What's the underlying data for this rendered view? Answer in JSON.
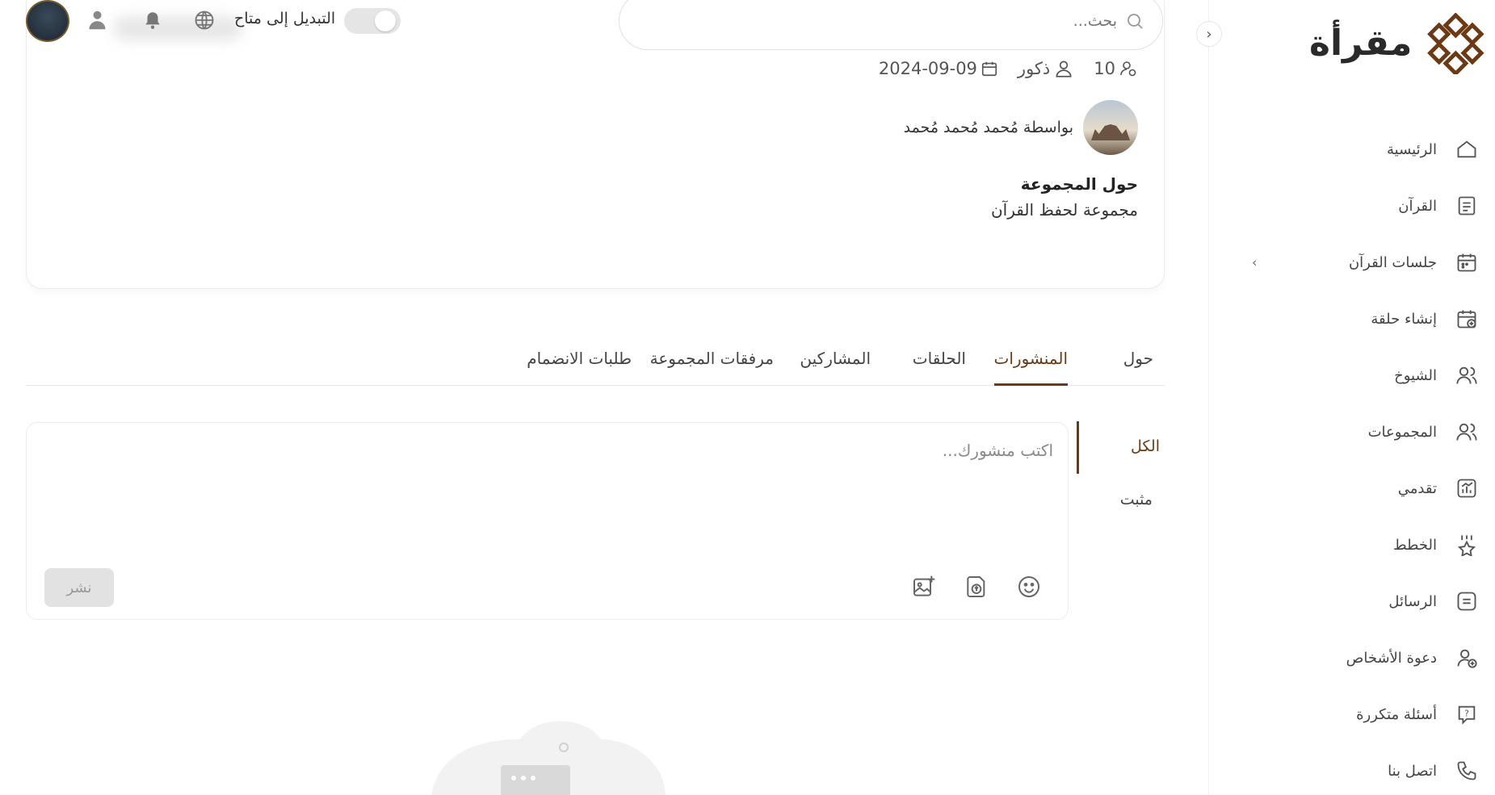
{
  "brand": {
    "name": "مقرأة",
    "accent": "#6b3a14"
  },
  "sidebar": {
    "items": [
      {
        "label": "الرئيسية",
        "icon": "home-icon"
      },
      {
        "label": "القرآن",
        "icon": "book-icon"
      },
      {
        "label": "جلسات القرآن",
        "icon": "calendar-icon",
        "has_submenu": true
      },
      {
        "label": "إنشاء حلقة",
        "icon": "calendar-add-icon"
      },
      {
        "label": "الشيوخ",
        "icon": "people-icon"
      },
      {
        "label": "المجموعات",
        "icon": "groups-icon"
      },
      {
        "label": "تقدمي",
        "icon": "progress-chart-icon"
      },
      {
        "label": "الخطط",
        "icon": "star-badge-icon"
      },
      {
        "label": "الرسائل",
        "icon": "message-icon"
      },
      {
        "label": "دعوة الأشخاص",
        "icon": "invite-user-icon"
      },
      {
        "label": "أسئلة متكررة",
        "icon": "faq-icon"
      },
      {
        "label": "اتصل بنا",
        "icon": "phone-icon"
      }
    ],
    "submenu_chevron": "‹",
    "collapse_chevron": "›"
  },
  "header": {
    "search_placeholder": "بحث...",
    "switch_label": "التبديل إلى متاح",
    "switch_on": false
  },
  "group": {
    "members_count": "10",
    "gender": "ذكور",
    "created_date": "2024-09-09",
    "by_text": "بواسطة مُحمد مُحمد مُحمد",
    "about_title": "حول المجموعة",
    "about_desc": "مجموعة لحفظ القرآن"
  },
  "tabs": [
    {
      "label": "حول",
      "active": false
    },
    {
      "label": "المنشورات",
      "active": true
    },
    {
      "label": "الحلقات",
      "active": false
    },
    {
      "label": "المشاركين",
      "active": false
    },
    {
      "label": "مرفقات المجموعة",
      "active": false
    },
    {
      "label": "طلبات الانضمام",
      "active": false
    }
  ],
  "filters": {
    "all": "الكل",
    "pinned": "مثبت"
  },
  "composer": {
    "placeholder": "اكتب منشورك...",
    "publish_label": "نشر"
  }
}
